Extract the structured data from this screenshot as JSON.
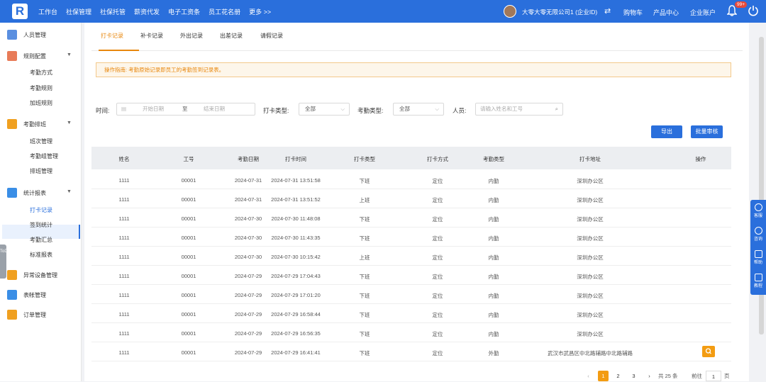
{
  "topbar": {
    "logo": "R",
    "nav": [
      "工作台",
      "社保管理",
      "社保托管",
      "薪资代发",
      "电子工资条",
      "员工花名册",
      "更多 >>"
    ],
    "company": "大零大零无限公司1 (企业ID)",
    "links": [
      "购物车",
      "产品中心",
      "企业账户"
    ],
    "badge": "99+"
  },
  "sidebar": {
    "groups": [
      {
        "label": "人员管理",
        "icon": "people-icon",
        "color": "#5a8fe0"
      },
      {
        "label": "规则配置",
        "icon": "rule-icon",
        "color": "#e87b58"
      },
      {
        "label": "考勤排班",
        "icon": "calendar-icon",
        "color": "#f0a020"
      },
      {
        "label": "统计报表",
        "icon": "chart-icon",
        "color": "#3a8ee6"
      },
      {
        "label": "异常设备管理",
        "icon": "warning-icon",
        "color": "#f0a020"
      },
      {
        "label": "表帐管理",
        "icon": "list-icon",
        "color": "#3a8ee6"
      },
      {
        "label": "订单管理",
        "icon": "order-icon",
        "color": "#f0a020"
      }
    ],
    "rule_items": [
      "考勤方式",
      "考勤规则",
      "加班规则"
    ],
    "schedule_items": [
      "班次管理",
      "考勤组管理",
      "排班管理"
    ],
    "report_items": [
      "打卡记录",
      "签到统计",
      "考勤汇总",
      "标准报表"
    ],
    "todo": "ToDo"
  },
  "tabs": [
    "打卡记录",
    "补卡记录",
    "外出记录",
    "出差记录",
    "请假记录"
  ],
  "notice": "操作指南: 考勤原始记录即员工的考勤签到记录表。",
  "filters": {
    "time_label": "时间:",
    "start_placeholder": "开始日期",
    "to": "至",
    "end_placeholder": "结束日期",
    "punch_type_label": "打卡类型:",
    "punch_type_value": "全部",
    "att_type_label": "考勤类型:",
    "att_type_value": "全部",
    "person_label": "人员:",
    "person_placeholder": "请输入姓名和工号"
  },
  "buttons": {
    "export": "导出",
    "batch": "批量审核"
  },
  "table": {
    "headers": [
      "姓名",
      "工号",
      "考勤日期",
      "打卡时间",
      "打卡类型",
      "打卡方式",
      "考勤类型",
      "打卡地址",
      "操作"
    ],
    "rows": [
      [
        "1111",
        "00001",
        "2024-07-31",
        "2024-07-31 13:51:58",
        "下班",
        "定位",
        "内勤",
        "深圳办公区"
      ],
      [
        "1111",
        "00001",
        "2024-07-31",
        "2024-07-31 13:51:52",
        "上班",
        "定位",
        "内勤",
        "深圳办公区"
      ],
      [
        "1111",
        "00001",
        "2024-07-30",
        "2024-07-30 11:48:08",
        "下班",
        "定位",
        "内勤",
        "深圳办公区"
      ],
      [
        "1111",
        "00001",
        "2024-07-30",
        "2024-07-30 11:43:35",
        "下班",
        "定位",
        "内勤",
        "深圳办公区"
      ],
      [
        "1111",
        "00001",
        "2024-07-30",
        "2024-07-30 10:15:42",
        "上班",
        "定位",
        "内勤",
        "深圳办公区"
      ],
      [
        "1111",
        "00001",
        "2024-07-29",
        "2024-07-29 17:04:43",
        "下班",
        "定位",
        "内勤",
        "深圳办公区"
      ],
      [
        "1111",
        "00001",
        "2024-07-29",
        "2024-07-29 17:01:20",
        "下班",
        "定位",
        "内勤",
        "深圳办公区"
      ],
      [
        "1111",
        "00001",
        "2024-07-29",
        "2024-07-29 16:58:44",
        "下班",
        "定位",
        "内勤",
        "深圳办公区"
      ],
      [
        "1111",
        "00001",
        "2024-07-29",
        "2024-07-29 16:56:35",
        "下班",
        "定位",
        "内勤",
        "深圳办公区"
      ],
      [
        "1111",
        "00001",
        "2024-07-29",
        "2024-07-29 16:41:41",
        "下班",
        "定位",
        "外勤",
        "武汉市武昌区中北路辅路中北路辅路"
      ]
    ]
  },
  "pagination": {
    "pages": [
      "1",
      "2",
      "3"
    ],
    "current": "1",
    "total": "共 25 条",
    "goto": "前往",
    "goto_value": "1",
    "page_unit": "页"
  },
  "rail": [
    "客服",
    "咨询",
    "帮助",
    "教程"
  ]
}
